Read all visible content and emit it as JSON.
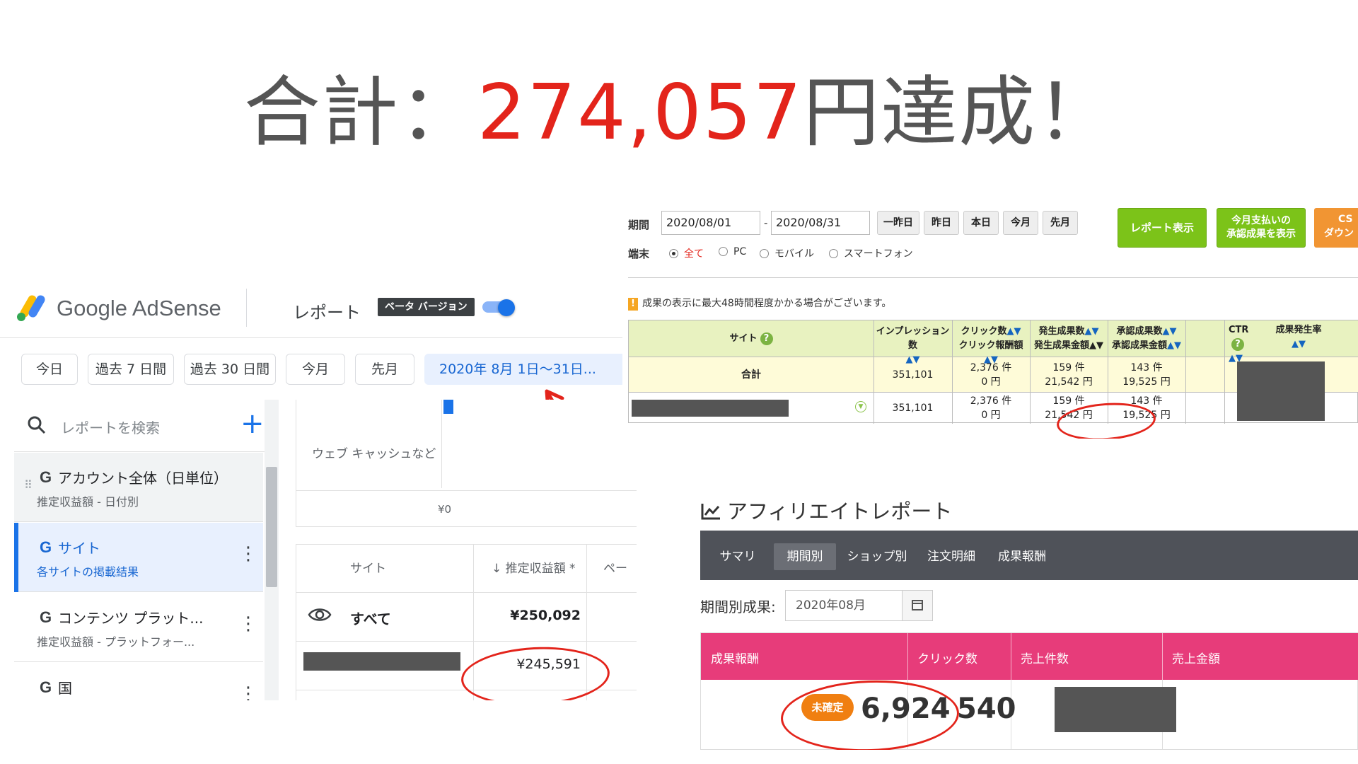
{
  "headline": {
    "prefix": "合計：",
    "amount": "274,057",
    "suffix": "円達成！"
  },
  "adsense": {
    "brand": "Google AdSense",
    "page_title": "レポート",
    "beta_label": "ベータ バージョン",
    "date_chips": [
      "今日",
      "過去 7 日間",
      "過去 30 日間",
      "今月",
      "先月"
    ],
    "date_range": "2020年 8月 1日〜31日...",
    "search_placeholder": "レポートを検索",
    "add_label": "+",
    "nav_items": [
      {
        "g": "G",
        "title": "アカウント全体（日単位）",
        "sub": "推定収益額 - 日付別"
      },
      {
        "g": "G",
        "title": "サイト",
        "sub": "各サイトの掲載結果"
      },
      {
        "g": "G",
        "title": "コンテンツ プラット...",
        "sub": "推定収益額 - プラットフォー..."
      },
      {
        "g": "G",
        "title": "国",
        "sub": ""
      }
    ],
    "chart_caption": "ウェブ キャッシュなど",
    "chart_zero": "¥0",
    "table_headers": {
      "site": "サイト",
      "earnings": "↓ 推定収益額 *",
      "more": "ペー"
    },
    "row_all": {
      "label": "すべて",
      "value": "¥250,092"
    },
    "row_site": {
      "value": "¥245,591"
    }
  },
  "asp": {
    "period_label": "期間",
    "date_from": "2020/08/01",
    "date_sep": "-",
    "date_to": "2020/08/31",
    "quick_buttons": [
      "一昨日",
      "昨日",
      "本日",
      "今月",
      "先月"
    ],
    "report_button": "レポート表示",
    "paid_button_line1": "今月支払いの",
    "paid_button_line2": "承認成果を表示",
    "csv_button_line1": "CS",
    "csv_button_line2": "ダウン",
    "device_label": "端末",
    "devices": [
      "全て",
      "PC",
      "モバイル",
      "スマートフォン"
    ],
    "notice": "成果の表示に最大48時間程度かかる場合がございます。",
    "headers": {
      "site": "サイト",
      "impressions": "インプレッション数",
      "clicks_1": "クリック数",
      "clicks_2": "クリック報酬額",
      "occ_1": "発生成果数",
      "occ_2": "発生成果金額",
      "appr_1": "承認成果数",
      "appr_2": "承認成果金額",
      "ctr": "CTR",
      "cvr": "成果発生率"
    },
    "total_label": "合計",
    "total": {
      "impressions": "351,101",
      "clicks": "2,376 件",
      "click_reward": "0 円",
      "occ_count": "159 件",
      "occ_amount": "21,542 円",
      "appr_count": "143 件",
      "appr_amount": "19,525 円"
    },
    "site_row": {
      "impressions": "351,101",
      "clicks": "2,376 件",
      "click_reward": "0 円",
      "occ_count": "159 件",
      "occ_amount": "21,542 円",
      "appr_count": "143 件",
      "appr_amount": "19,525 円"
    }
  },
  "affiliate": {
    "title": "アフィリエイトレポート",
    "tabs": [
      "サマリ",
      "期間別",
      "ショップ別",
      "注文明細",
      "成果報酬"
    ],
    "period_label": "期間別成果:",
    "month_value": "2020年08月",
    "headers": [
      "成果報酬",
      "クリック数",
      "売上件数",
      "売上金額"
    ],
    "badge": "未確定",
    "reward": "6,924",
    "clicks": "540"
  },
  "colors": {
    "accent_red": "#e3241b",
    "adsense_blue": "#1a73e8",
    "asp_green": "#7cc319",
    "aff_pink": "#e73c7a",
    "aff_badge": "#f07f11"
  }
}
